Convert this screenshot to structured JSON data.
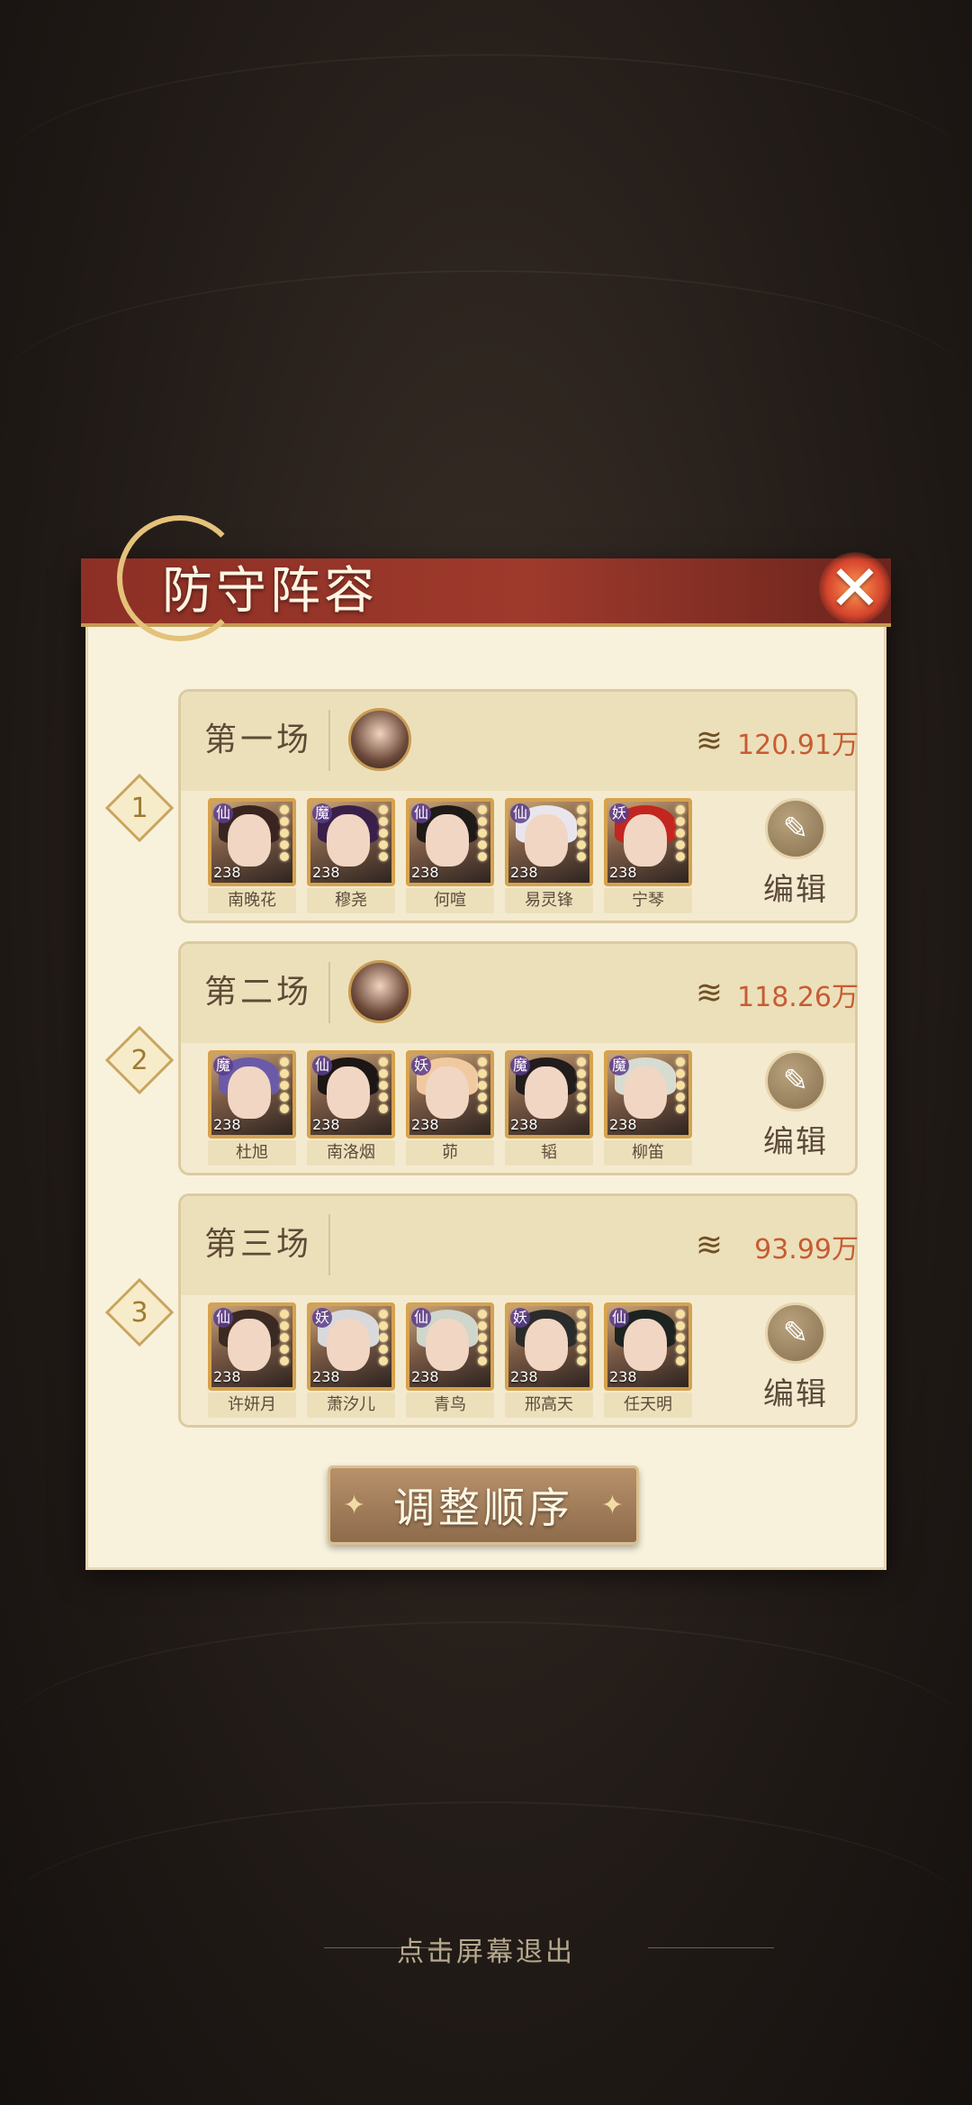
{
  "dialog": {
    "title": "防守阵容",
    "adjust_button": "调整顺序",
    "exit_hint": "点击屏幕退出",
    "edit_label": "编辑"
  },
  "battles": [
    {
      "rank": "1",
      "name": "第一场",
      "power": "120.91万",
      "heroes": [
        {
          "name": "南晚花",
          "faction": "仙",
          "level": "238",
          "hair": "#3a2420"
        },
        {
          "name": "穆尧",
          "faction": "魔",
          "level": "238",
          "hair": "#3a1f4a"
        },
        {
          "name": "何喧",
          "faction": "仙",
          "level": "238",
          "hair": "#1e1a18"
        },
        {
          "name": "易灵锋",
          "faction": "仙",
          "level": "238",
          "hair": "#e8e6ec"
        },
        {
          "name": "宁琴",
          "faction": "妖",
          "level": "238",
          "hair": "#c2261f"
        }
      ]
    },
    {
      "rank": "2",
      "name": "第二场",
      "power": "118.26万",
      "heroes": [
        {
          "name": "杜旭",
          "faction": "魔",
          "level": "238",
          "hair": "#6a5aa8"
        },
        {
          "name": "南洛烟",
          "faction": "仙",
          "level": "238",
          "hair": "#1c1614"
        },
        {
          "name": "茆",
          "faction": "妖",
          "level": "238",
          "hair": "#f1c9a0"
        },
        {
          "name": "韬",
          "faction": "魔",
          "level": "238",
          "hair": "#221c1c"
        },
        {
          "name": "柳笛",
          "faction": "魔",
          "level": "238",
          "hair": "#d7dcd0"
        }
      ]
    },
    {
      "rank": "3",
      "name": "第三场",
      "power": "93.99万",
      "heroes": [
        {
          "name": "许妍月",
          "faction": "仙",
          "level": "238",
          "hair": "#3b2a22"
        },
        {
          "name": "萧汐儿",
          "faction": "妖",
          "level": "238",
          "hair": "#d9d9dc"
        },
        {
          "name": "青鸟",
          "faction": "仙",
          "level": "238",
          "hair": "#cfd6cc"
        },
        {
          "name": "邢高天",
          "faction": "妖",
          "level": "238",
          "hair": "#2b2b2b"
        },
        {
          "name": "任天明",
          "faction": "仙",
          "level": "238",
          "hair": "#1d2320"
        }
      ]
    }
  ]
}
